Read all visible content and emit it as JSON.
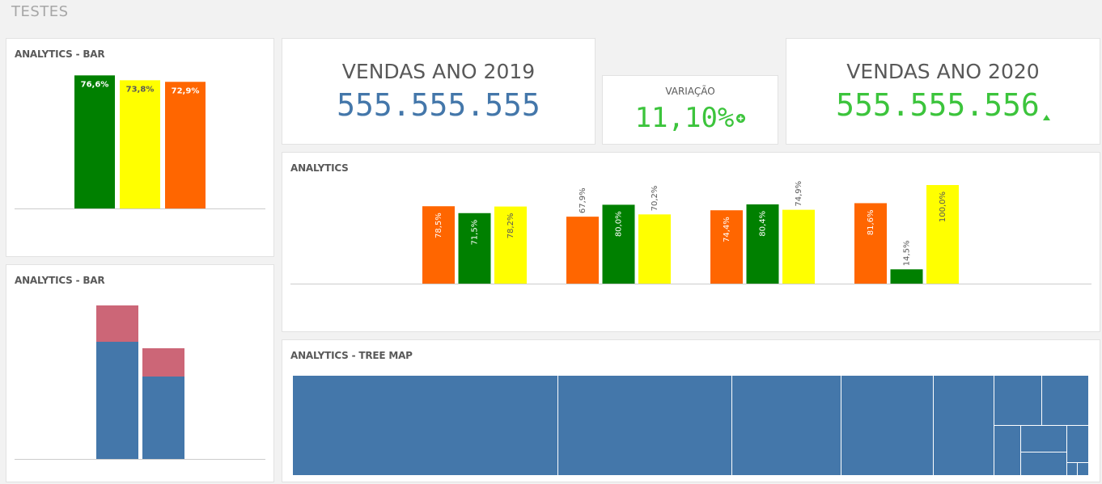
{
  "sheet": {
    "title": "TESTES"
  },
  "kpi_2019": {
    "label": "VENDAS ANO 2019",
    "value": "555.555.555",
    "color": "#4477aa"
  },
  "kpi_variacao": {
    "label": "VARIAÇÃO",
    "value": "11,10%",
    "icon": "plus-circle-icon",
    "color": "#3cc43c"
  },
  "kpi_2020": {
    "label": "VENDAS ANO 2020",
    "value": "555.555.556",
    "icon": "triangle-up-icon",
    "color": "#3cc43c"
  },
  "colors": {
    "green": "#008000",
    "yellow": "#ffff00",
    "orange": "#ff6600",
    "blue": "#4477aa",
    "rose": "#cc6677"
  },
  "chart_data": [
    {
      "id": "bar1",
      "type": "bar",
      "title": "ANALYTICS - BAR",
      "ylim": [
        0,
        100
      ],
      "grid": false,
      "bars": [
        {
          "value": 76.6,
          "label": "76,6%",
          "color": "#008000",
          "text_color": "#ffffff"
        },
        {
          "value": 73.8,
          "label": "73,8%",
          "color": "#ffff00",
          "text_color": "#595959"
        },
        {
          "value": 72.9,
          "label": "72,9%",
          "color": "#ff6600",
          "text_color": "#ffffff"
        }
      ]
    },
    {
      "id": "bar2",
      "type": "bar",
      "title": "ANALYTICS - BAR",
      "stacked": true,
      "grid": false,
      "stacks": [
        {
          "segments": [
            {
              "value": 145,
              "color": "#4477aa"
            },
            {
              "value": 45,
              "color": "#cc6677"
            }
          ]
        },
        {
          "segments": [
            {
              "value": 102,
              "color": "#4477aa"
            },
            {
              "value": 35,
              "color": "#cc6677"
            }
          ]
        }
      ]
    },
    {
      "id": "bar3",
      "type": "bar",
      "title": "ANALYTICS",
      "ylim": [
        0,
        100
      ],
      "grid": false,
      "groups": [
        {
          "bars": [
            {
              "value": 78.5,
              "label": "78,5%",
              "color": "#ff6600",
              "text_color": "#ffffff"
            },
            {
              "value": 71.5,
              "label": "71,5%",
              "color": "#008000",
              "text_color": "#ffffff"
            },
            {
              "value": 78.2,
              "label": "78,2%",
              "color": "#ffff00",
              "text_color": "#595959"
            }
          ]
        },
        {
          "bars": [
            {
              "value": 67.9,
              "label": "67,9%",
              "color": "#ff6600",
              "text_color": "#595959"
            },
            {
              "value": 80.0,
              "label": "80,0%",
              "color": "#008000",
              "text_color": "#ffffff"
            },
            {
              "value": 70.2,
              "label": "70,2%",
              "color": "#ffff00",
              "text_color": "#595959"
            }
          ]
        },
        {
          "bars": [
            {
              "value": 74.4,
              "label": "74,4%",
              "color": "#ff6600",
              "text_color": "#ffffff"
            },
            {
              "value": 80.4,
              "label": "80,4%",
              "color": "#008000",
              "text_color": "#ffffff"
            },
            {
              "value": 74.9,
              "label": "74,9%",
              "color": "#ffff00",
              "text_color": "#595959"
            }
          ]
        },
        {
          "bars": [
            {
              "value": 81.6,
              "label": "81,6%",
              "color": "#ff6600",
              "text_color": "#ffffff"
            },
            {
              "value": 14.5,
              "label": "14,5%",
              "color": "#008000",
              "text_color": "#595959"
            },
            {
              "value": 100.0,
              "label": "100,0%",
              "color": "#ffff00",
              "text_color": "#595959"
            }
          ]
        }
      ]
    },
    {
      "id": "treemap",
      "type": "treemap",
      "title": "ANALYTICS - TREE MAP",
      "color": "#4477aa"
    }
  ]
}
